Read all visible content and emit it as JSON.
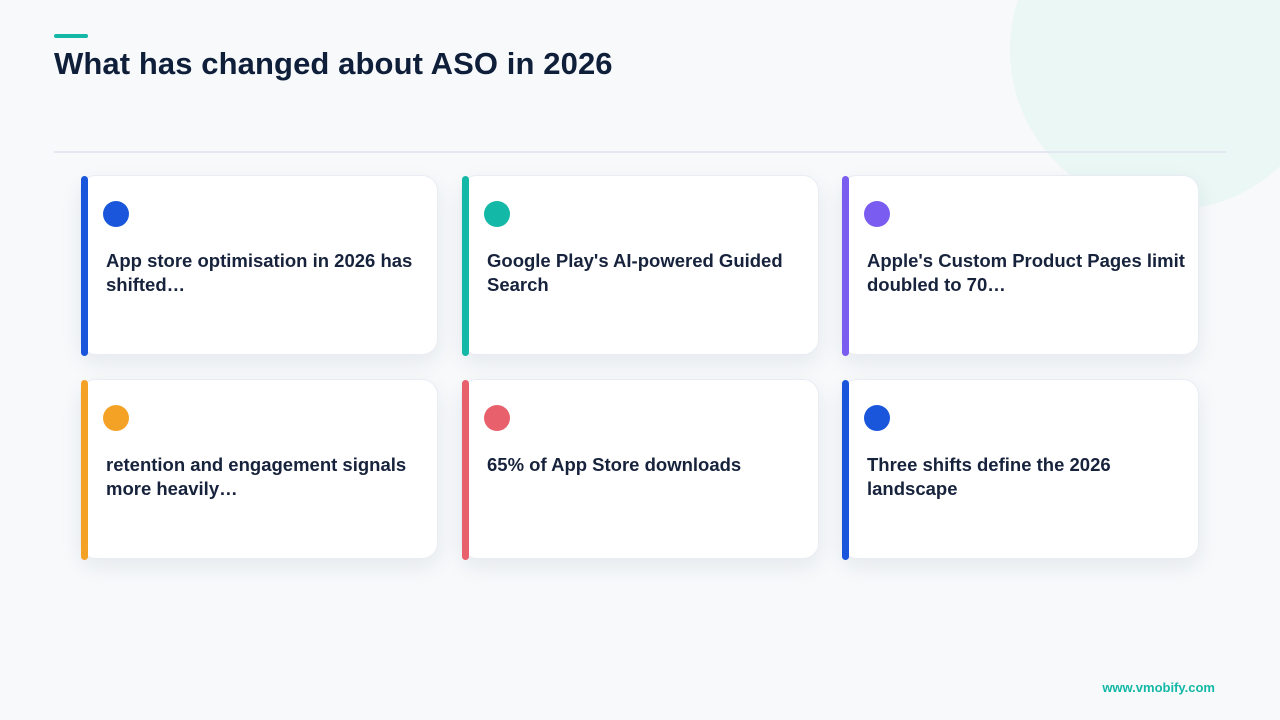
{
  "slide": {
    "title": "What has changed about ASO in 2026"
  },
  "colors": {
    "background": "#f7f9fb",
    "accent": "#14b8a6",
    "blue": "#1a56db",
    "teal": "#14b8a6",
    "purple": "#7b5cf0",
    "orange": "#f4a226",
    "red": "#e8606c"
  },
  "cards": [
    {
      "text": "App store optimisation in 2026 has shifted…",
      "color": "#1a56db",
      "icon": "dot-icon"
    },
    {
      "text": "Google Play's AI-powered Guided Search",
      "color": "#14b8a6",
      "icon": "dot-icon"
    },
    {
      "text": "Apple's Custom Product Pages limit doubled to 70…",
      "color": "#7b5cf0",
      "icon": "dot-icon"
    },
    {
      "text": "retention and engagement signals more heavily…",
      "color": "#f4a226",
      "icon": "dot-icon"
    },
    {
      "text": "65% of App Store downloads",
      "color": "#e8606c",
      "icon": "dot-icon"
    },
    {
      "text": "Three shifts define the 2026 landscape",
      "color": "#1a56db",
      "icon": "dot-icon"
    }
  ],
  "footer": {
    "url": "www.vmobify.com"
  }
}
